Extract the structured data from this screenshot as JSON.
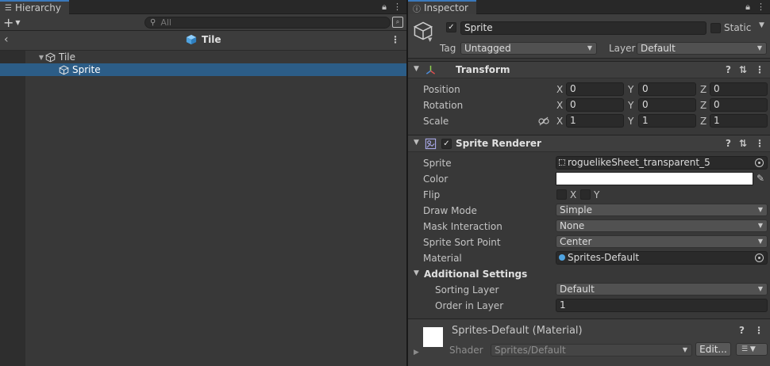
{
  "hierarchy": {
    "tab_label": "Hierarchy",
    "search_placeholder": "All",
    "breadcrumb": "Tile",
    "tree": [
      {
        "label": "Tile",
        "depth": 0,
        "expanded": true,
        "selected": false
      },
      {
        "label": "Sprite",
        "depth": 1,
        "expanded": false,
        "selected": true
      }
    ]
  },
  "inspector": {
    "tab_label": "Inspector",
    "object": {
      "active": true,
      "name": "Sprite",
      "static_label": "Static",
      "static": false,
      "tag_label": "Tag",
      "tag": "Untagged",
      "layer_label": "Layer",
      "layer": "Default"
    },
    "transform": {
      "title": "Transform",
      "rows": [
        {
          "label": "Position",
          "x": "0",
          "y": "0",
          "z": "0"
        },
        {
          "label": "Rotation",
          "x": "0",
          "y": "0",
          "z": "0"
        },
        {
          "label": "Scale",
          "x": "1",
          "y": "1",
          "z": "1"
        }
      ],
      "axes": {
        "x": "X",
        "y": "Y",
        "z": "Z"
      }
    },
    "sprite_renderer": {
      "title": "Sprite Renderer",
      "enabled": true,
      "sprite_label": "Sprite",
      "sprite": "roguelikeSheet_transparent_5",
      "color_label": "Color",
      "color_value": "#ffffff",
      "flip_label": "Flip",
      "flip_x": "X",
      "flip_y": "Y",
      "draw_mode_label": "Draw Mode",
      "draw_mode": "Simple",
      "mask_label": "Mask Interaction",
      "mask": "None",
      "sort_point_label": "Sprite Sort Point",
      "sort_point": "Center",
      "material_label": "Material",
      "material": "Sprites-Default",
      "additional_title": "Additional Settings",
      "sorting_layer_label": "Sorting Layer",
      "sorting_layer": "Default",
      "order_label": "Order in Layer",
      "order": "1"
    },
    "material": {
      "name": "Sprites-Default (Material)",
      "shader_label": "Shader",
      "shader": "Sprites/Default",
      "edit_label": "Edit..."
    }
  },
  "colors": {
    "selection": "#2c5d87",
    "panel": "#383838",
    "accent_tab": "#3a79bb",
    "prefab_blue": "#4fa3e0"
  }
}
